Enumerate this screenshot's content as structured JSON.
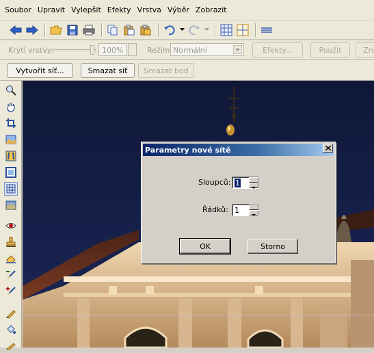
{
  "menu": [
    "Soubor",
    "Upravit",
    "Vylepšit",
    "Efekty",
    "Vrstva",
    "Výběr",
    "Zobrazit"
  ],
  "toolbar": {
    "icons": [
      "back-arrow-icon",
      "forward-arrow-icon",
      "open-folder-icon",
      "save-icon",
      "print-icon",
      "copy-icon",
      "paste-icon",
      "paste-special-icon",
      "undo-icon",
      "redo-icon",
      "grid-icon",
      "grid-alt-icon",
      "menu-icon"
    ]
  },
  "layer_bar": {
    "opacity_label": "Krytí vrstvy:",
    "opacity_value": "100%",
    "mode_label": "Režim:",
    "mode_value": "Normální",
    "effects_button": "Efekty...",
    "apply_button": "Použít",
    "zoom_button": "Zru"
  },
  "grid_bar": {
    "create_button": "Vytvořit síť...",
    "delete_grid_button": "Smazat síť",
    "delete_point_button": "Smazat bod"
  },
  "tools": [
    "zoom-icon",
    "hand-icon",
    "crop-icon",
    "image-icon",
    "deform-icon",
    "frame-icon",
    "grid-tool-icon",
    "gradient-icon",
    "red-eye-icon",
    "stamp-icon",
    "eraser-icon",
    "brush-minus-icon",
    "brush-plus-icon",
    "pencil-icon",
    "fill-icon",
    "paint-icon"
  ],
  "dialog": {
    "title": "Parametry nové sítě",
    "columns_label": "Sloupců:",
    "columns_value": "1",
    "rows_label": "Řádků:",
    "rows_value": "1",
    "ok_button": "OK",
    "cancel_button": "Storno"
  },
  "colors": {
    "accent": "#0a246a",
    "sky": "#16204a",
    "building": "#d9b891"
  }
}
